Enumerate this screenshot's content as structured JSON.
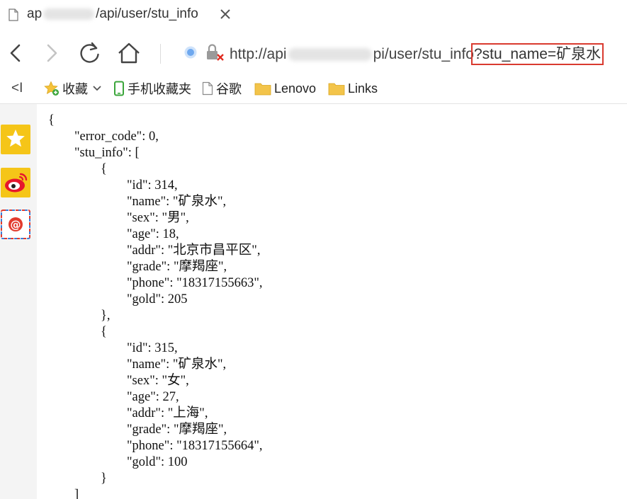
{
  "tab": {
    "title_prefix": "ap",
    "title_suffix": "/api/user/stu_info",
    "close_icon": "close-icon"
  },
  "nav": {
    "back_icon": "back-arrow-icon",
    "forward_icon": "forward-arrow-icon",
    "reload_icon": "reload-icon",
    "home_icon": "home-icon"
  },
  "address": {
    "url_prefix": "http://api",
    "url_middle": "pi/user/stu_info",
    "url_query": "?stu_name=矿泉水",
    "highlight_color": "#d93a2f"
  },
  "bookmarks": {
    "collapse_label": "<I",
    "items": [
      {
        "label": "收藏",
        "icon": "star-add-icon"
      },
      {
        "label": "手机收藏夹",
        "icon": "phone-icon"
      },
      {
        "label": "谷歌",
        "icon": "page-icon"
      },
      {
        "label": "Lenovo",
        "icon": "folder-icon"
      },
      {
        "label": "Links",
        "icon": "folder-icon"
      }
    ]
  },
  "sidebar": {
    "items": [
      {
        "name": "favorites",
        "icon": "star-icon",
        "color": "#f5c518"
      },
      {
        "name": "weibo",
        "icon": "weibo-icon",
        "color": "#f5c518"
      },
      {
        "name": "mail",
        "icon": "at-mail-icon",
        "color": "#e23b2e"
      }
    ]
  },
  "response": {
    "error_code": 0,
    "stu_info": [
      {
        "id": 314,
        "name": "矿泉水",
        "sex": "男",
        "age": 18,
        "addr": "北京市昌平区",
        "grade": "摩羯座",
        "phone": "18317155663",
        "gold": 205
      },
      {
        "id": 315,
        "name": "矿泉水",
        "sex": "女",
        "age": 27,
        "addr": "上海",
        "grade": "摩羯座",
        "phone": "18317155664",
        "gold": 100
      }
    ]
  }
}
